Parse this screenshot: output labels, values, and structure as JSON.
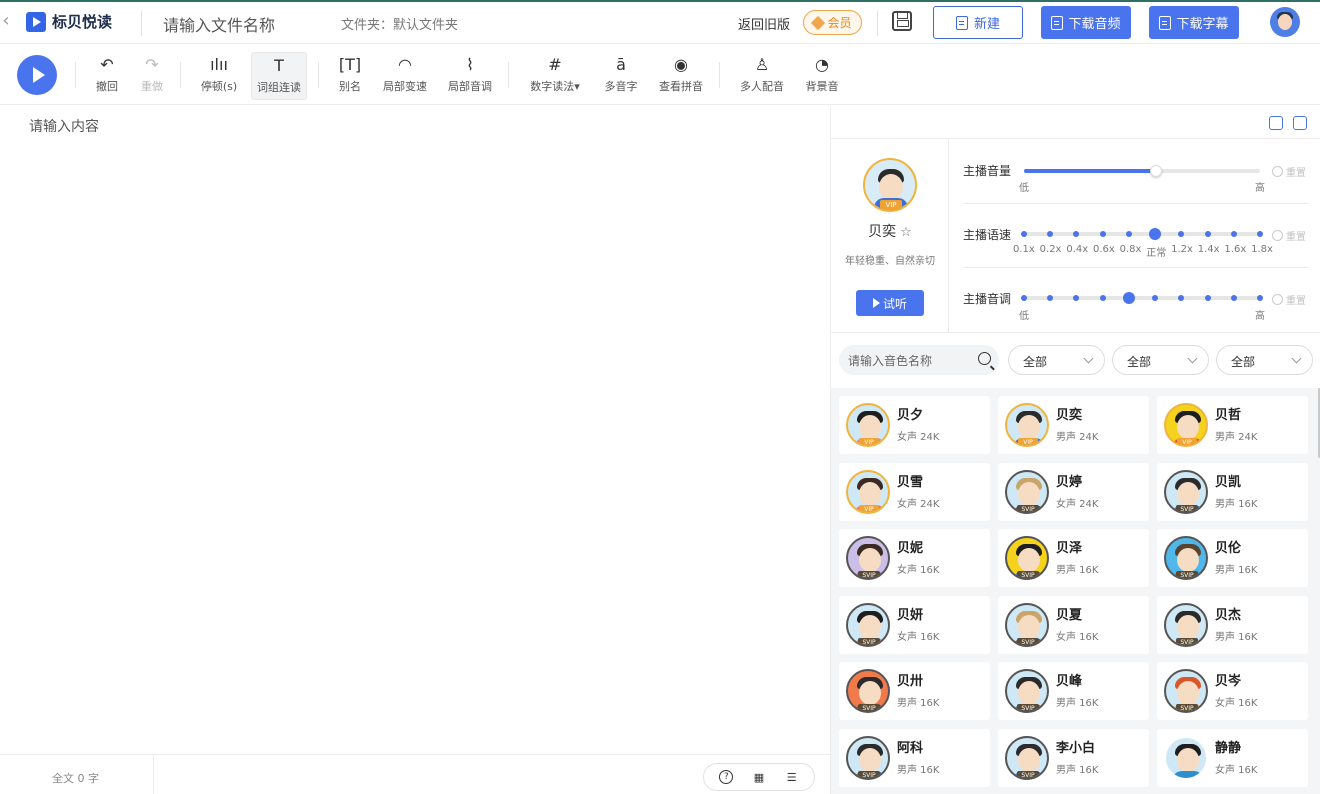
{
  "header": {
    "back_icon": "‹",
    "logo_text": "标贝悦读",
    "file_name_placeholder": "请输入文件名称",
    "folder_label": "文件夹：默认文件夹",
    "old_version": "返回旧版",
    "vip_label": "会员",
    "new_label": "新建",
    "download_audio": "下载音频",
    "download_subtitle": "下载字幕"
  },
  "toolbar": {
    "tools": [
      {
        "label": "撤回",
        "icon": "↶",
        "name": "undo"
      },
      {
        "label": "重做",
        "icon": "↷",
        "name": "redo"
      },
      {
        "label": "停顿(s)",
        "icon": "ılıı",
        "name": "pause"
      },
      {
        "label": "词组连读",
        "icon": "T",
        "name": "phrase-link"
      },
      {
        "label": "别名",
        "icon": "[T]",
        "name": "alias"
      },
      {
        "label": "局部变速",
        "icon": "◠",
        "name": "local-speed"
      },
      {
        "label": "局部音调",
        "icon": "⌇",
        "name": "local-pitch"
      },
      {
        "label": "数字读法▾",
        "icon": "#",
        "name": "number-reading"
      },
      {
        "label": "多音字",
        "icon": "ā",
        "name": "polyphone"
      },
      {
        "label": "查看拼音",
        "icon": "◉",
        "name": "view-pinyin"
      },
      {
        "label": "多人配音",
        "icon": "♙",
        "name": "multi-voice"
      },
      {
        "label": "背景音",
        "icon": "◔",
        "name": "bgm"
      }
    ]
  },
  "editor": {
    "placeholder": "请输入内容",
    "word_count": "全文 0 字"
  },
  "speaker": {
    "name": "贝奕",
    "star": "☆",
    "description": "年轻稳重、自然亲切",
    "badge": "VIP",
    "try_label": "试听"
  },
  "sliders": {
    "volume": {
      "label": "主播音量",
      "low": "低",
      "high": "高",
      "value": 0.56,
      "reset": "重置"
    },
    "speed": {
      "label": "主播语速",
      "ticks": [
        "0.1x",
        "0.2x",
        "0.4x",
        "0.6x",
        "0.8x",
        "正常",
        "1.2x",
        "1.4x",
        "1.6x",
        "1.8x"
      ],
      "selected_index": 5,
      "reset": "重置"
    },
    "pitch": {
      "label": "主播音调",
      "low": "低",
      "high": "高",
      "steps": 10,
      "selected_index": 4,
      "reset": "重置"
    }
  },
  "filters": {
    "search_placeholder": "请输入音色名称",
    "dropdowns": [
      "全部",
      "全部",
      "全部"
    ]
  },
  "voices": [
    {
      "name": "贝夕",
      "meta": "女声 24K",
      "badge": "VIP",
      "hair": "#1e1e1e",
      "body": "#f07c93",
      "ring": "#f0b43c",
      "bg": "#cfe8f5"
    },
    {
      "name": "贝奕",
      "meta": "男声 24K",
      "badge": "VIP",
      "hair": "#2b2b2b",
      "body": "#3d6fd9",
      "ring": "#f0b43c",
      "bg": "#cfe8f5"
    },
    {
      "name": "贝哲",
      "meta": "男声 24K",
      "badge": "VIP",
      "hair": "#1e1e1e",
      "body": "#e54646",
      "ring": "#f0b43c",
      "bg": "#f5d21c"
    },
    {
      "name": "贝雪",
      "meta": "女声 24K",
      "badge": "VIP",
      "hair": "#3a2a22",
      "body": "#e76d7d",
      "ring": "#f0b43c",
      "bg": "#cfe8f5"
    },
    {
      "name": "贝婷",
      "meta": "女声 24K",
      "badge": "SVIP",
      "hair": "#c9a56a",
      "body": "#6b4b3a",
      "ring": "#555555",
      "bg": "#cfe8f5"
    },
    {
      "name": "贝凯",
      "meta": "男声 16K",
      "badge": "SVIP",
      "hair": "#2b2b2b",
      "body": "#3d6fd9",
      "ring": "#555555",
      "bg": "#cfe8f5"
    },
    {
      "name": "贝妮",
      "meta": "女声 16K",
      "badge": "SVIP",
      "hair": "#3a2a22",
      "body": "#8a78c9",
      "ring": "#555555",
      "bg": "#cbbfe8"
    },
    {
      "name": "贝泽",
      "meta": "男声 16K",
      "badge": "SVIP",
      "hair": "#1e1e1e",
      "body": "#3d6fd9",
      "ring": "#555555",
      "bg": "#f5d21c"
    },
    {
      "name": "贝伦",
      "meta": "男声 16K",
      "badge": "SVIP",
      "hair": "#5a4430",
      "body": "#2f9ad1",
      "ring": "#555555",
      "bg": "#4fb7ea"
    },
    {
      "name": "贝妍",
      "meta": "女声 16K",
      "badge": "SVIP",
      "hair": "#1e1e1e",
      "body": "#e76d7d",
      "ring": "#555555",
      "bg": "#cfe8f5"
    },
    {
      "name": "贝夏",
      "meta": "女声 16K",
      "badge": "SVIP",
      "hair": "#c9a56a",
      "body": "#6b4b3a",
      "ring": "#555555",
      "bg": "#cfe8f5"
    },
    {
      "name": "贝杰",
      "meta": "男声 16K",
      "badge": "SVIP",
      "hair": "#2b2b2b",
      "body": "#c7ced8",
      "ring": "#555555",
      "bg": "#cfe8f5"
    },
    {
      "name": "贝卅",
      "meta": "男声 16K",
      "badge": "SVIP",
      "hair": "#2b2b2b",
      "body": "#3d6fd9",
      "ring": "#555555",
      "bg": "#f07a4a"
    },
    {
      "name": "贝峰",
      "meta": "男声 16K",
      "badge": "SVIP",
      "hair": "#2b2b2b",
      "body": "#3d6fd9",
      "ring": "#555555",
      "bg": "#cfe8f5"
    },
    {
      "name": "贝岑",
      "meta": "女声 16K",
      "badge": "SVIP",
      "hair": "#d9582a",
      "body": "#e7a646",
      "ring": "#555555",
      "bg": "#cfe8f5"
    },
    {
      "name": "阿科",
      "meta": "男声 16K",
      "badge": "SVIP",
      "hair": "#2b2b2b",
      "body": "#3d6fd9",
      "ring": "#555555",
      "bg": "#cfe8f5"
    },
    {
      "name": "李小白",
      "meta": "男声 16K",
      "badge": "SVIP",
      "hair": "#2b2b2b",
      "body": "#3d6fd9",
      "ring": "#555555",
      "bg": "#cfe8f5"
    },
    {
      "name": "静静",
      "meta": "女声 16K",
      "badge": "",
      "hair": "#1e1e1e",
      "body": "#2f8ed0",
      "ring": "#ffffff",
      "bg": "#cfe8f5"
    }
  ]
}
